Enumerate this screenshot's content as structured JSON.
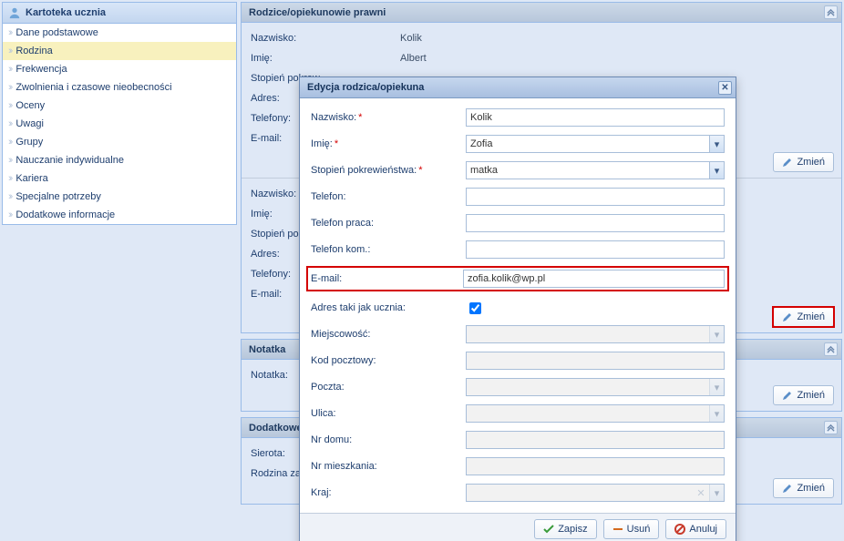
{
  "sidebar": {
    "title": "Kartoteka ucznia",
    "items": [
      {
        "label": "Dane podstawowe"
      },
      {
        "label": "Rodzina"
      },
      {
        "label": "Frekwencja"
      },
      {
        "label": "Zwolnienia i czasowe nieobecności"
      },
      {
        "label": "Oceny"
      },
      {
        "label": "Uwagi"
      },
      {
        "label": "Grupy"
      },
      {
        "label": "Nauczanie indywidualne"
      },
      {
        "label": "Kariera"
      },
      {
        "label": "Specjalne potrzeby"
      },
      {
        "label": "Dodatkowe informacje"
      }
    ]
  },
  "panels": {
    "parents": {
      "title": "Rodzice/opiekunowie prawni",
      "labels": {
        "surname": "Nazwisko:",
        "name": "Imię:",
        "relation": "Stopień pokrew",
        "address": "Adres:",
        "phones": "Telefony:",
        "email": "E-mail:"
      },
      "p1": {
        "surname": "Kolik",
        "name": "Albert"
      },
      "btn_change": "Zmień"
    },
    "note": {
      "title": "Notatka",
      "label": "Notatka:",
      "btn_change": "Zmień"
    },
    "extra": {
      "title": "Dodatkowe inf",
      "orphan_label": "Sierota:",
      "foster_label": "Rodzina zastępc",
      "btn_change": "Zmień"
    }
  },
  "dialog": {
    "title": "Edycja rodzica/opiekuna",
    "labels": {
      "surname": "Nazwisko:",
      "name": "Imię:",
      "relation": "Stopień pokrewieństwa:",
      "phone": "Telefon:",
      "phone_work": "Telefon praca:",
      "phone_mob": "Telefon kom.:",
      "email": "E-mail:",
      "addr_same": "Adres taki jak ucznia:",
      "city": "Miejscowość:",
      "zip": "Kod pocztowy:",
      "post": "Poczta:",
      "street": "Ulica:",
      "house": "Nr domu:",
      "flat": "Nr mieszkania:",
      "country": "Kraj:"
    },
    "values": {
      "surname": "Kolik",
      "name": "Zofia",
      "relation": "matka",
      "email": "zofia.kolik@wp.pl",
      "addr_same": true
    },
    "buttons": {
      "save": "Zapisz",
      "delete": "Usuń",
      "cancel": "Anuluj"
    }
  }
}
